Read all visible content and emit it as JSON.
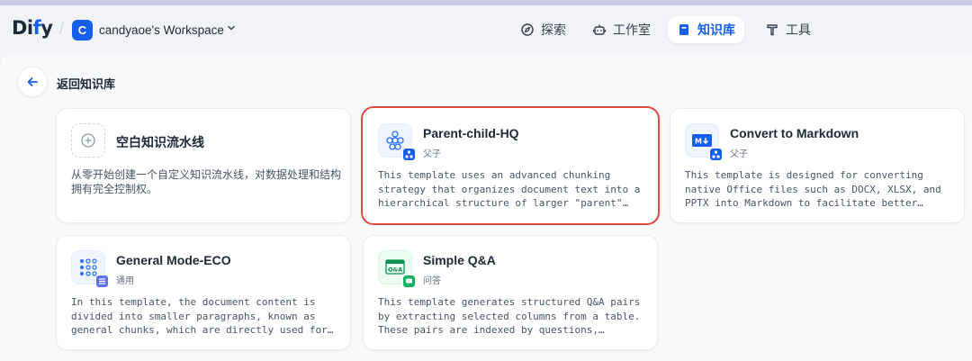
{
  "header": {
    "logo_main": "Di",
    "logo_dot": "f",
    "logo_tail": "y",
    "workspace_initial": "C",
    "workspace_name": "candyaoe's Workspace",
    "nav": [
      {
        "label": "探索",
        "icon": "compass-icon"
      },
      {
        "label": "工作室",
        "icon": "robot-icon"
      },
      {
        "label": "知识库",
        "icon": "book-icon",
        "active": true
      },
      {
        "label": "工具",
        "icon": "tool-icon"
      }
    ]
  },
  "main": {
    "back_label": "返回知识库",
    "cards": [
      {
        "title": "空白知识流水线",
        "tag": "",
        "description": "从零开始创建一个自定义知识流水线，对数据处理和结构拥有完全控制权。",
        "icon": "plus-circle-icon"
      },
      {
        "title": "Parent-child-HQ",
        "tag": "父子",
        "description": "This template uses an advanced chunking strategy that organizes document text into a hierarchical structure of larger \"parent\" chunks and smaller child chunks for precise retrieval.",
        "icon": "hierarchy-icon",
        "highlighted": true
      },
      {
        "title": "Convert to Markdown",
        "tag": "父子",
        "description": "This template is designed for converting native Office files such as DOCX, XLSX, and PPTX into Markdown to facilitate better information processing. PDF files are not recommended.",
        "icon": "markdown-icon"
      },
      {
        "title": "General Mode-ECO",
        "tag": "通用",
        "description": "In this template, the document content is divided into smaller paragraphs, known as general chunks, which are directly used for matching user queries and retrieval.",
        "icon": "grid-dots-icon"
      },
      {
        "title": "Simple Q&A",
        "tag": "问答",
        "description": "This template generates structured Q&A pairs by extracting selected columns from a table. These pairs are indexed by questions, enabling efficient retrieval of relevant answers.",
        "icon": "qa-icon"
      }
    ]
  },
  "colors": {
    "accent": "#155eef",
    "highlight_border": "#e04a3a",
    "qa_green": "#16b364"
  }
}
